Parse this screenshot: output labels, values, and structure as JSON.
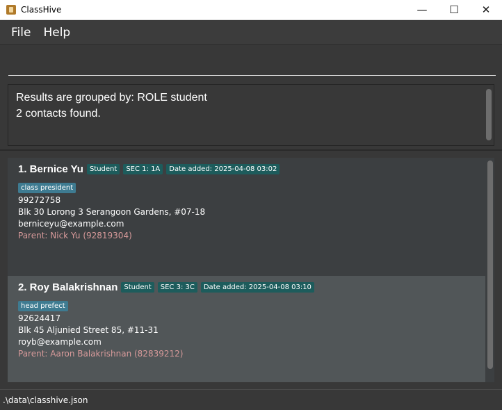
{
  "window": {
    "title": "ClassHive",
    "minimize_glyph": "—",
    "maximize_glyph": "☐",
    "close_glyph": "✕"
  },
  "menu": {
    "items": [
      {
        "label": "File"
      },
      {
        "label": "Help"
      }
    ]
  },
  "command": {
    "value": "",
    "placeholder": ""
  },
  "result": {
    "line1": "Results are grouped by: ROLE student",
    "line2": "2 contacts found."
  },
  "contacts": [
    {
      "name": "1.  Bernice Yu",
      "role": "Student",
      "class": "SEC 1: 1A",
      "date_added": "Date added: 2025-04-08 03:02",
      "tag": "class president",
      "phone": "99272758",
      "address": "Blk 30 Lorong 3 Serangoon Gardens, #07-18",
      "email": "berniceyu@example.com",
      "parent": "Parent: Nick Yu (92819304)"
    },
    {
      "name": "2.  Roy Balakrishnan",
      "role": "Student",
      "class": "SEC 3: 3C",
      "date_added": "Date added: 2025-04-08 03:10",
      "tag": "head prefect",
      "phone": "92624417",
      "address": "Blk 45 Aljunied Street 85, #11-31",
      "email": "royb@example.com",
      "parent": "Parent: Aaron Balakrishnan (82839212)"
    }
  ],
  "status": {
    "file_path": ".\\data\\classhive.json"
  },
  "colors": {
    "background": "#383838",
    "badge": "#1d5c5c",
    "tag": "#3e7b91",
    "parent_text": "#d79a9a",
    "selected_card": "#515658"
  },
  "icons": {
    "app": "app-icon",
    "minimize": "minimize-icon",
    "maximize": "maximize-icon",
    "close": "close-icon"
  }
}
